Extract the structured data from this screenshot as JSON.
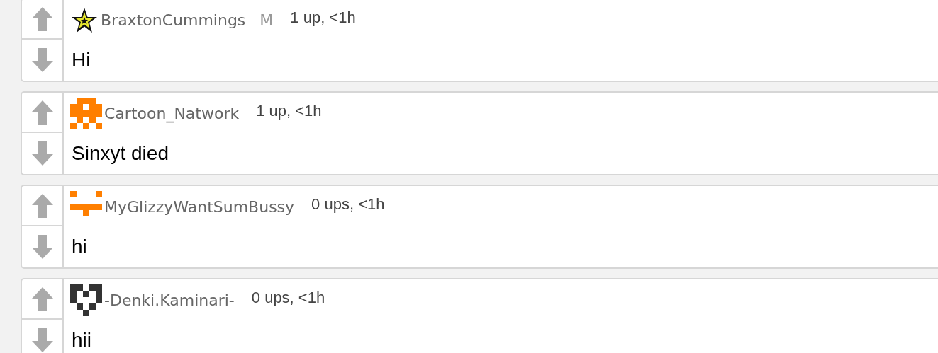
{
  "comments": [
    {
      "kind": "star",
      "username": "BraxtonCummings",
      "badge": "M",
      "meta": "1 up, <1h",
      "text": "Hi"
    },
    {
      "kind": "identicon",
      "color": "#ff7f00",
      "username": "Cartoon_Natwork",
      "meta": "1 up, <1h",
      "text": "Sinxyt died"
    },
    {
      "kind": "identicon",
      "color": "#ff7f00",
      "username": "MyGlizzyWantSumBussy",
      "meta": "0 ups, <1h",
      "text": "hi"
    },
    {
      "kind": "identicon",
      "color": "#333333",
      "username": "-Denki.Kaminari-",
      "meta": "0 ups, <1h",
      "text": "hii"
    }
  ]
}
